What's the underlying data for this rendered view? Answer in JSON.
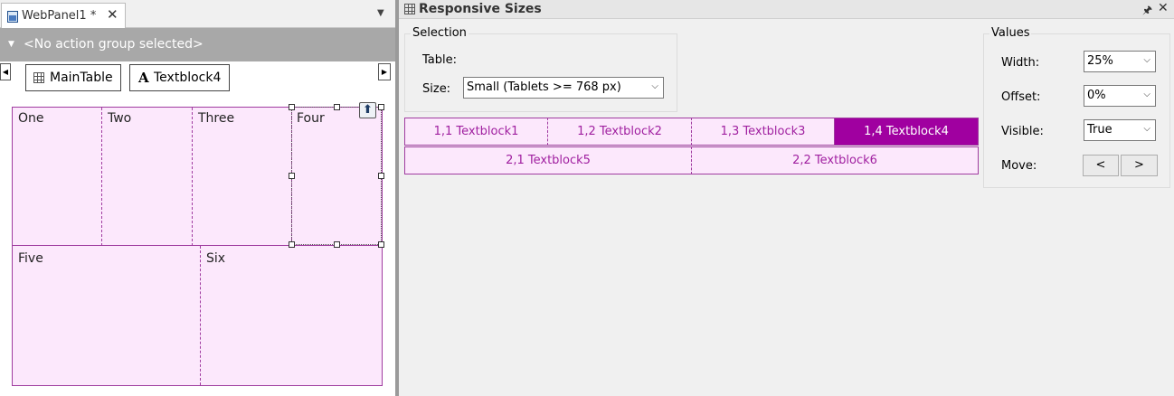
{
  "left_panel": {
    "tab": {
      "label": "WebPanel1 *",
      "close_glyph": "✕"
    },
    "dropdown_glyph": "▼",
    "action_group": {
      "label": "<No action group selected>"
    },
    "breadcrumbs": [
      {
        "label": "MainTable",
        "icon": "grid-icon"
      },
      {
        "label": "Textblock4",
        "icon": "text-icon",
        "glyph": "A"
      }
    ],
    "nav": {
      "left": "◀",
      "right": "▶"
    },
    "canvas": {
      "row1": [
        "One",
        "Two",
        "Three",
        "Four"
      ],
      "row2": [
        "Five",
        "Six"
      ]
    }
  },
  "right_panel": {
    "title": "Responsive Sizes",
    "pin_glyph": "🖈",
    "close_glyph": "✕",
    "selection": {
      "legend": "Selection",
      "table_label": "Table:",
      "size_label": "Size:",
      "size_value": "Small (Tablets >= 768 px)"
    },
    "values": {
      "legend": "Values",
      "width_label": "Width:",
      "width_value": "25%",
      "offset_label": "Offset:",
      "offset_value": "0%",
      "visible_label": "Visible:",
      "visible_value": "True",
      "move_label": "Move:",
      "move_left": "<",
      "move_right": ">"
    },
    "grid": {
      "row1": [
        "1,1 Textblock1",
        "1,2 Textblock2",
        "1,3 Textblock3",
        "1,4 Textblock4"
      ],
      "row2": [
        "2,1 Textblock5",
        "2,2 Textblock6"
      ],
      "selected": "1,4 Textblock4"
    }
  },
  "colors": {
    "accent": "#a000a0",
    "cell_bg": "#fce8fc",
    "action_bar": "#a8a8a8"
  }
}
